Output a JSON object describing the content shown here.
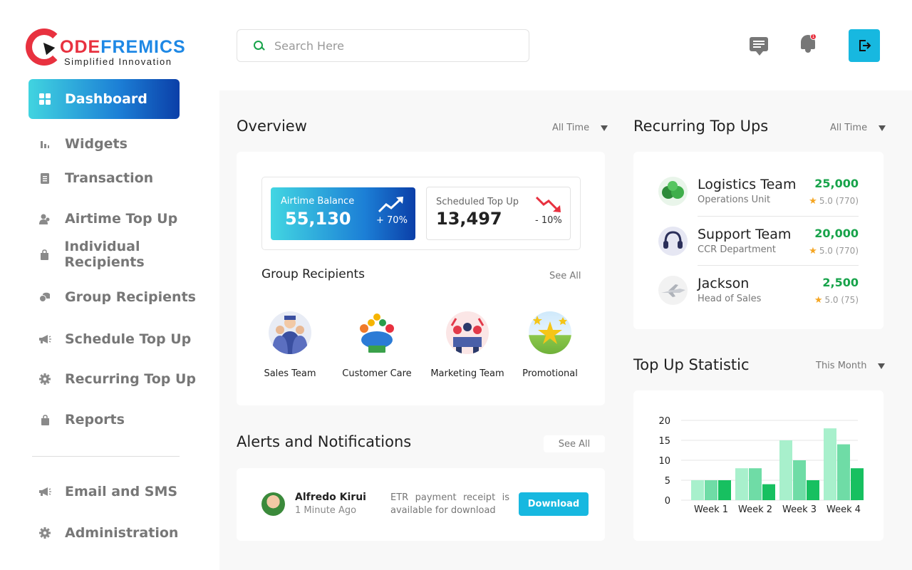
{
  "brand": {
    "name_part1": "ODE",
    "name_part2": "FREMICS",
    "tagline": "Simplified Innovation"
  },
  "sidebar": {
    "items": [
      {
        "label": "Dashboard",
        "icon": "grid-icon",
        "active": true
      },
      {
        "label": "Widgets",
        "icon": "bar-chart-icon"
      },
      {
        "label": "Transaction",
        "icon": "document-icon"
      },
      {
        "label": "Airtime Top Up",
        "icon": "users-icon"
      },
      {
        "label": "Individual Recipients",
        "icon": "bag-icon"
      },
      {
        "label": "Group Recipients",
        "icon": "coins-icon"
      },
      {
        "label": "Schedule Top Up",
        "icon": "megaphone-icon"
      },
      {
        "label": "Recurring Top Up",
        "icon": "gear-icon"
      },
      {
        "label": "Reports",
        "icon": "bag-icon"
      },
      {
        "label": "Email and SMS",
        "icon": "megaphone-icon"
      },
      {
        "label": "Administration",
        "icon": "gear-icon"
      }
    ]
  },
  "header": {
    "search_placeholder": "Search Here",
    "notification_count": "1"
  },
  "overview": {
    "title": "Overview",
    "filter": "All Time",
    "airtime": {
      "label": "Airtime Balance",
      "value": "55,130",
      "change": "+ 70%"
    },
    "scheduled": {
      "label": "Scheduled Top Up",
      "value": "13,497",
      "change": "- 10%"
    },
    "groups_title": "Group Recipients",
    "see_all": "See All",
    "groups": [
      {
        "name": "Sales Team"
      },
      {
        "name": "Customer Care"
      },
      {
        "name": "Marketing Team"
      },
      {
        "name": "Promotional"
      }
    ]
  },
  "alerts": {
    "title": "Alerts and Notifications",
    "see_all": "See All",
    "item": {
      "name": "Alfredo Kirui",
      "time": "1 Minute Ago",
      "message": "ETR payment receipt is available for download",
      "action": "Download"
    }
  },
  "recurring": {
    "title": "Recurring Top Ups",
    "filter": "All Time",
    "items": [
      {
        "name": "Logistics Team",
        "sub": "Operations Unit",
        "amount": "25,000",
        "rating": "5.0 (770)"
      },
      {
        "name": "Support Team",
        "sub": "CCR Department",
        "amount": "20,000",
        "rating": "5.0 (770)"
      },
      {
        "name": "Jackson",
        "sub": "Head of Sales",
        "amount": "2,500",
        "rating": "5.0 (75)"
      }
    ]
  },
  "statistic": {
    "title": "Top Up Statistic",
    "filter": "This Month"
  },
  "chart_data": {
    "type": "bar",
    "categories": [
      "Week 1",
      "Week 2",
      "Week 3",
      "Week 4"
    ],
    "series": [
      {
        "values": [
          5,
          8,
          15,
          18
        ],
        "color": "#a8f0cc"
      },
      {
        "values": [
          5,
          8,
          10,
          14
        ],
        "color": "#6fdca6"
      },
      {
        "values": [
          5,
          4,
          5,
          8
        ],
        "color": "#17c060"
      }
    ],
    "yticks": [
      0,
      5,
      10,
      15,
      20
    ],
    "ylim": [
      0,
      20
    ],
    "grid": true
  }
}
